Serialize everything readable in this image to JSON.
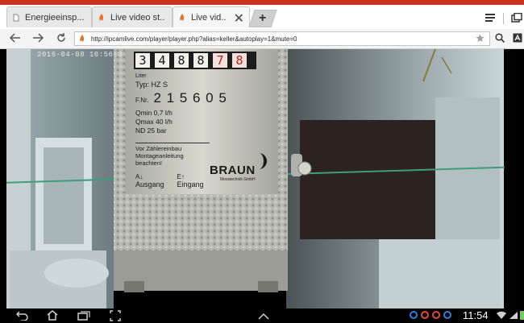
{
  "browser": {
    "tabs": [
      {
        "label": "Energieeinsp...",
        "icon": "page-icon",
        "active": false
      },
      {
        "label": "Live video st..",
        "icon": "flame-icon",
        "active": false
      },
      {
        "label": "Live vid..",
        "icon": "flame-icon",
        "active": true
      }
    ],
    "close_glyph": "✕",
    "newtab_glyph": "+",
    "url": "http://ipcamlive.com/player/player.php?alias=keller&autoplay=1&mute=0"
  },
  "video": {
    "timestamp": "2016-04-08 10:56:3",
    "meter": {
      "digits": [
        "3",
        "4",
        "8",
        "8",
        "7",
        "8"
      ],
      "unit": "Liter",
      "type": "Typ: HZ S",
      "fnr_label": "F.Nr.",
      "fnr": "2 1 5 6 0 5",
      "qmin": "Qmin 0,7 l/h",
      "qmax": "Qmax 40 l/h",
      "nd": "ND 25 bar",
      "note1": "Vor Zählereinbau",
      "note2": "Montageanleitung",
      "note3": "beachten!",
      "out_code": "A↓",
      "out_label": "Ausgang",
      "in_code": "E↑",
      "in_label": "Eingang",
      "brand": "BRAUN",
      "brand_sub": "Messtechnik GmbH"
    }
  },
  "statusbar": {
    "time": "11:54"
  },
  "colors": {
    "brand_red": "#c8321e",
    "notif_blue": "#2d7fe6"
  }
}
